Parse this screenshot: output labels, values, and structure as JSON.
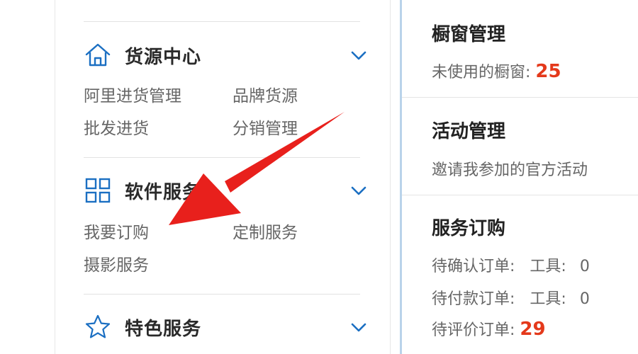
{
  "sidebar": {
    "sections": [
      {
        "title": "货源中心",
        "links": [
          "阿里进货管理",
          "品牌货源",
          "批发进货",
          "分销管理"
        ]
      },
      {
        "title": "软件服务",
        "links": [
          "我要订购",
          "定制服务",
          "摄影服务"
        ]
      },
      {
        "title": "特色服务",
        "links": []
      }
    ]
  },
  "main": {
    "window_card": {
      "title": "橱窗管理",
      "label": "未使用的橱窗:",
      "value": "25"
    },
    "activity_card": {
      "title": "活动管理",
      "text": "邀请我参加的官方活动"
    },
    "service_card": {
      "title": "服务订购",
      "rows": [
        {
          "label": "待确认订单:",
          "tool_label": "工具:",
          "tool_value": "0"
        },
        {
          "label": "待付款订单:",
          "tool_label": "工具:",
          "tool_value": "0"
        }
      ],
      "review_label": "待评价订单:",
      "review_value": "29"
    }
  },
  "colors": {
    "accent_blue": "#1b6fc2",
    "highlight_red": "#e4391b",
    "arrow_red": "#e8201c",
    "divider_blue": "#b9d3ea"
  },
  "icons": {
    "section_0": "home-icon",
    "section_1": "grid-icon",
    "section_2": "star-icon",
    "expand": "chevron-down-icon",
    "annotation": "red-arrow-icon"
  }
}
